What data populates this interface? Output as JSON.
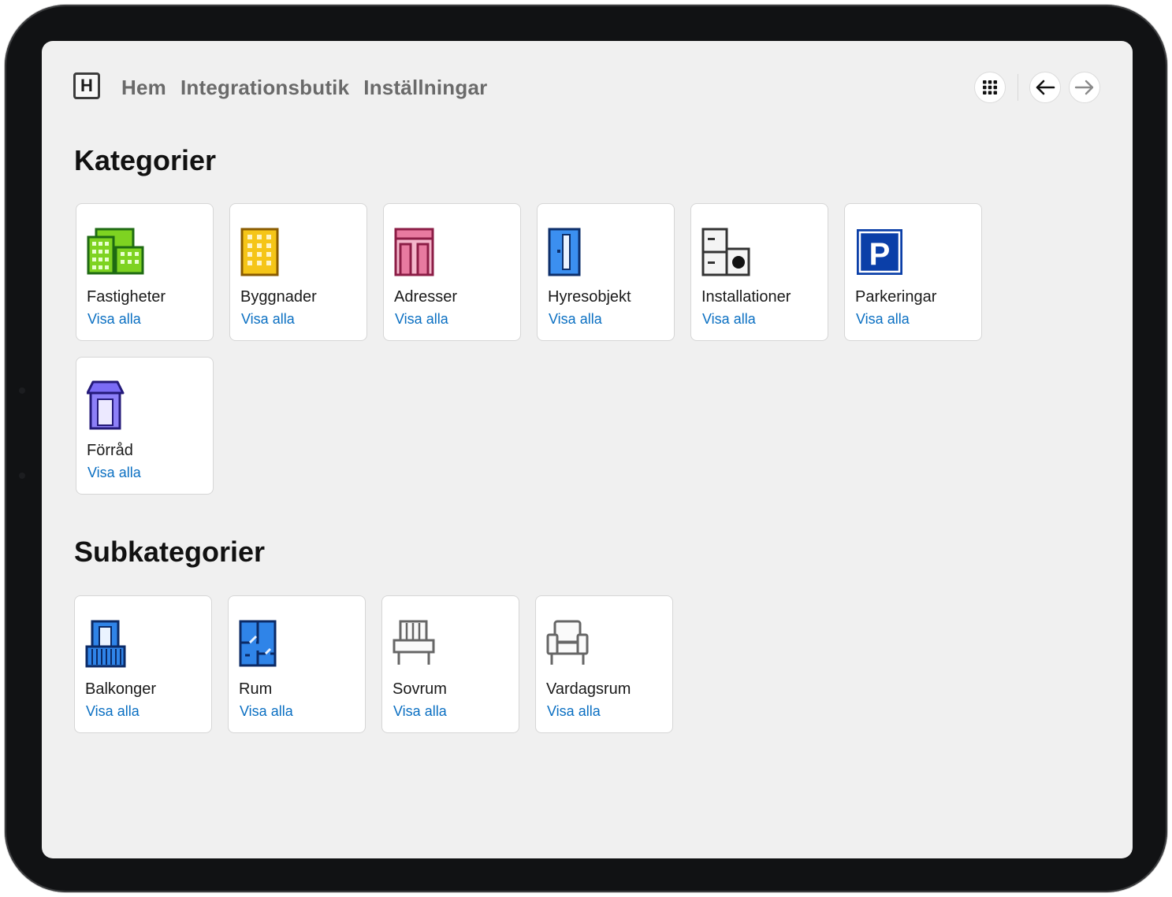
{
  "header": {
    "logo_letter": "H",
    "nav": [
      {
        "label": "Hem"
      },
      {
        "label": "Integrationsbutik"
      },
      {
        "label": "Inställningar"
      }
    ]
  },
  "categories": {
    "title": "Kategorier",
    "items": [
      {
        "label": "Fastigheter",
        "link": "Visa alla",
        "icon": "buildings-icon"
      },
      {
        "label": "Byggnader",
        "link": "Visa alla",
        "icon": "building-icon"
      },
      {
        "label": "Adresser",
        "link": "Visa alla",
        "icon": "address-icon"
      },
      {
        "label": "Hyresobjekt",
        "link": "Visa alla",
        "icon": "door-icon"
      },
      {
        "label": "Installationer",
        "link": "Visa alla",
        "icon": "installation-icon"
      },
      {
        "label": "Parkeringar",
        "link": "Visa alla",
        "icon": "parking-icon"
      },
      {
        "label": "Förråd",
        "link": "Visa alla",
        "icon": "storage-icon"
      }
    ]
  },
  "subcategories": {
    "title": "Subkategorier",
    "items": [
      {
        "label": "Balkonger",
        "link": "Visa alla",
        "icon": "balcony-icon"
      },
      {
        "label": "Rum",
        "link": "Visa alla",
        "icon": "floorplan-icon"
      },
      {
        "label": "Sovrum",
        "link": "Visa alla",
        "icon": "bed-icon"
      },
      {
        "label": "Vardagsrum",
        "link": "Visa alla",
        "icon": "armchair-icon"
      }
    ]
  },
  "colors": {
    "link": "#0a6fc2",
    "screen_bg": "#f0f0f0",
    "fastigheter_icon": "#7ed321",
    "byggnader_icon": "#f5c518",
    "adresser_icon": "#e87aa0",
    "hyresobjekt_icon": "#3b8ff0",
    "parkering_icon": "#0b3fa8",
    "forrad_icon": "#7b6cf6",
    "balkong_icon": "#2f84e8"
  }
}
